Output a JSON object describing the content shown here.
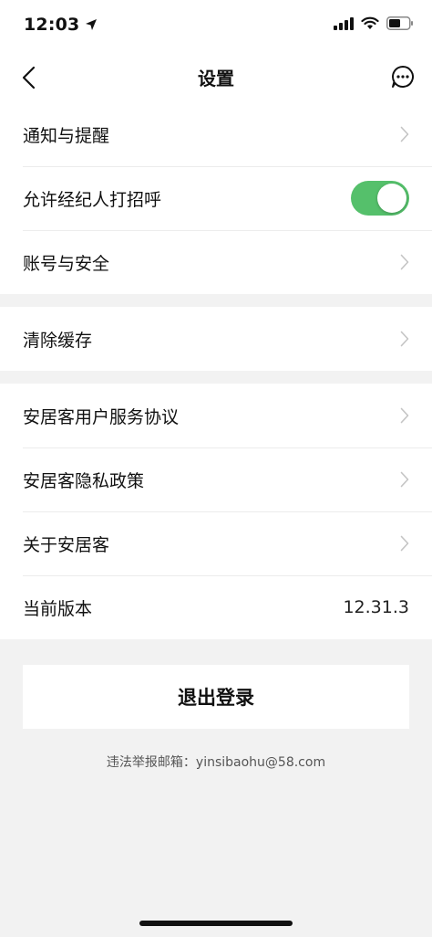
{
  "status_bar": {
    "time": "12:03"
  },
  "nav": {
    "title": "设置"
  },
  "group1": {
    "items": [
      {
        "label": "通知与提醒"
      },
      {
        "label": "允许经纪人打招呼",
        "toggle_on": true
      },
      {
        "label": "账号与安全"
      }
    ]
  },
  "group2": {
    "items": [
      {
        "label": "清除缓存"
      }
    ]
  },
  "group3": {
    "items": [
      {
        "label": "安居客用户服务协议"
      },
      {
        "label": "安居客隐私政策"
      },
      {
        "label": "关于安居客"
      },
      {
        "label": "当前版本",
        "value": "12.31.3"
      }
    ]
  },
  "logout": {
    "label": "退出登录"
  },
  "report": {
    "text": "违法举报邮箱：yinsibaohu@58.com"
  },
  "colors": {
    "toggle_on": "#55c06b",
    "background": "#f2f2f2"
  }
}
